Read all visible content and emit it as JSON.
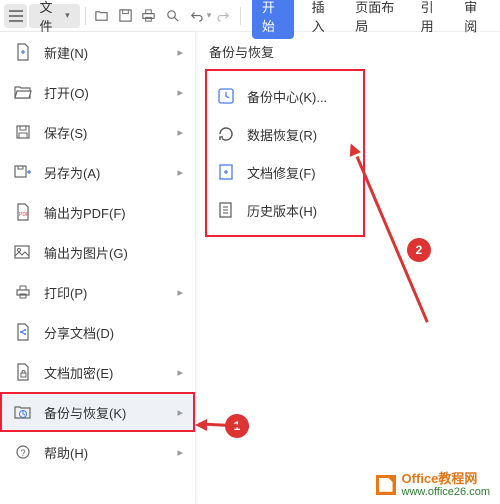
{
  "toolbar": {
    "file_label": "文件"
  },
  "tabs": {
    "start": "开始",
    "insert": "插入",
    "layout": "页面布局",
    "reference": "引用",
    "review": "审阅"
  },
  "filemenu": [
    {
      "label": "新建(N)",
      "arrow": true
    },
    {
      "label": "打开(O)",
      "arrow": true
    },
    {
      "label": "保存(S)",
      "arrow": true
    },
    {
      "label": "另存为(A)",
      "arrow": true
    },
    {
      "label": "输出为PDF(F)",
      "arrow": false
    },
    {
      "label": "输出为图片(G)",
      "arrow": false
    },
    {
      "label": "打印(P)",
      "arrow": true
    },
    {
      "label": "分享文档(D)",
      "arrow": false
    },
    {
      "label": "文档加密(E)",
      "arrow": true
    },
    {
      "label": "备份与恢复(K)",
      "arrow": true
    },
    {
      "label": "帮助(H)",
      "arrow": true
    }
  ],
  "submenu": {
    "title": "备份与恢复",
    "items": [
      {
        "label": "备份中心(K)..."
      },
      {
        "label": "数据恢复(R)"
      },
      {
        "label": "文档修复(F)"
      },
      {
        "label": "历史版本(H)"
      }
    ]
  },
  "badges": {
    "one": "1",
    "two": "2"
  },
  "watermark": {
    "brand": "Office教程网",
    "url": "www.office26.com"
  }
}
